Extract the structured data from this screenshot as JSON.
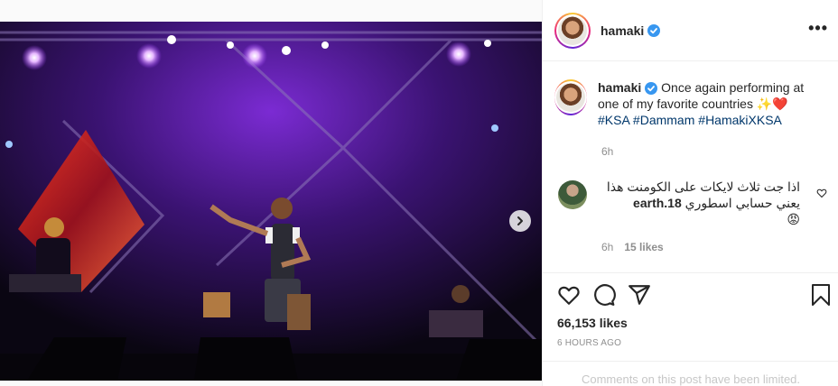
{
  "post": {
    "username": "hamaki",
    "verified_icon": "verified-badge-icon",
    "more_icon": "more-options-icon",
    "more_label": "•••",
    "caption_text": "Once again performing at one of my favorite countries",
    "caption_emoji": "✨❤️",
    "hashtags": [
      "#KSA",
      "#Dammam",
      "#HamakiXKSA"
    ],
    "caption_time": "6h"
  },
  "comment": {
    "username": "earth.18",
    "text": "اذا جت ثلاث لايكات على الكومنت هذا يعني حسابي اسطوري",
    "emoji": "😡",
    "time": "6h",
    "likes": "15 likes",
    "like_icon": "heart-outline-icon"
  },
  "actions": {
    "icons": [
      "heart-icon",
      "comment-icon",
      "share-icon",
      "bookmark-icon"
    ]
  },
  "likes_count": "66,153 likes",
  "posted_ago": "6 hours ago",
  "comments_limited": "Comments on this post have been limited.",
  "carousel": {
    "slides": 8,
    "active_index": 0,
    "next_icon": "chevron-right-icon"
  },
  "colors": {
    "link": "#00376b",
    "verified": "#3897f0",
    "muted": "#8e8e8e",
    "stage_purple": "#6a1fbf"
  }
}
